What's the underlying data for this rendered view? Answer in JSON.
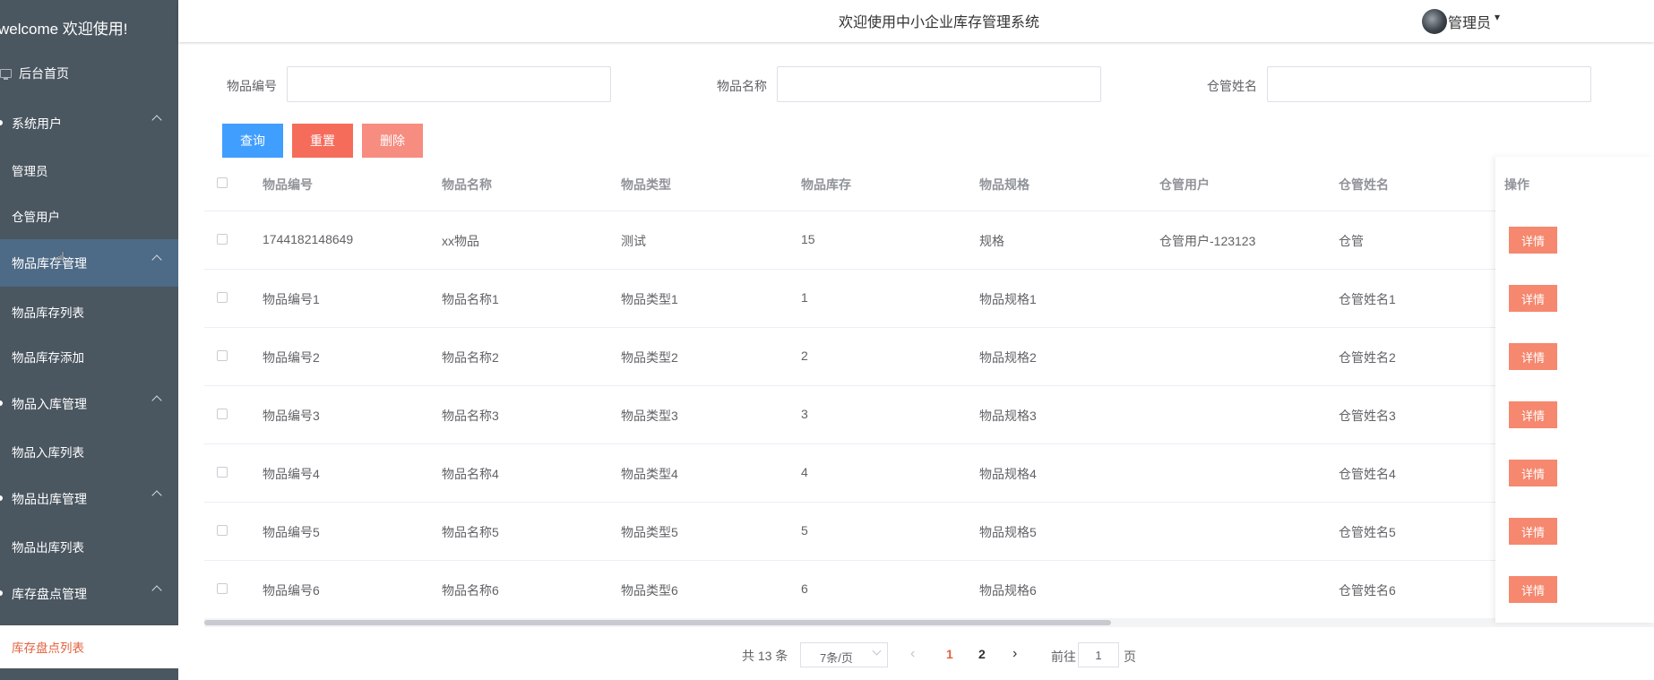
{
  "sidebar": {
    "brand": "welcome 欢迎使用!",
    "home": "后台首页",
    "groups": [
      {
        "label": "系统用户",
        "items": [
          "管理员",
          "仓管用户"
        ]
      },
      {
        "label": "物品库存管理",
        "items": [
          "物品库存列表",
          "物品库存添加"
        ]
      },
      {
        "label": "物品入库管理",
        "items": [
          "物品入库列表"
        ]
      },
      {
        "label": "物品出库管理",
        "items": [
          "物品出库列表"
        ]
      },
      {
        "label": "库存盘点管理",
        "items": [
          "库存盘点列表"
        ]
      }
    ]
  },
  "header": {
    "title": "欢迎使用中小企业库存管理系统",
    "user": "管理员"
  },
  "search": {
    "fields": [
      {
        "label": "物品编号",
        "value": ""
      },
      {
        "label": "物品名称",
        "value": ""
      },
      {
        "label": "仓管姓名",
        "value": ""
      }
    ],
    "buttons": {
      "query": "查询",
      "reset": "重置",
      "delete": "删除"
    },
    "colors": {
      "query": "#409eff",
      "reset": "#f56c5b",
      "delete": "#f78c80"
    }
  },
  "table": {
    "headers": [
      "物品编号",
      "物品名称",
      "物品类型",
      "物品库存",
      "物品规格",
      "仓管用户",
      "仓管姓名",
      "操作"
    ],
    "rows": [
      [
        "1744182148649",
        "xx物品",
        "测试",
        "15",
        "规格",
        "仓管用户-123123",
        "仓管"
      ],
      [
        "物品编号1",
        "物品名称1",
        "物品类型1",
        "1",
        "物品规格1",
        "",
        "仓管姓名1"
      ],
      [
        "物品编号2",
        "物品名称2",
        "物品类型2",
        "2",
        "物品规格2",
        "",
        "仓管姓名2"
      ],
      [
        "物品编号3",
        "物品名称3",
        "物品类型3",
        "3",
        "物品规格3",
        "",
        "仓管姓名3"
      ],
      [
        "物品编号4",
        "物品名称4",
        "物品类型4",
        "4",
        "物品规格4",
        "",
        "仓管姓名4"
      ],
      [
        "物品编号5",
        "物品名称5",
        "物品类型5",
        "5",
        "物品规格5",
        "",
        "仓管姓名5"
      ],
      [
        "物品编号6",
        "物品名称6",
        "物品类型6",
        "6",
        "物品规格6",
        "",
        "仓管姓名6"
      ]
    ],
    "detail_label": "详情"
  },
  "pager": {
    "total": "共 13 条",
    "page_size": "7条/页",
    "pages": [
      "1",
      "2"
    ],
    "current": "1",
    "goto_prefix": "前往",
    "goto_value": "1",
    "goto_suffix": "页"
  }
}
